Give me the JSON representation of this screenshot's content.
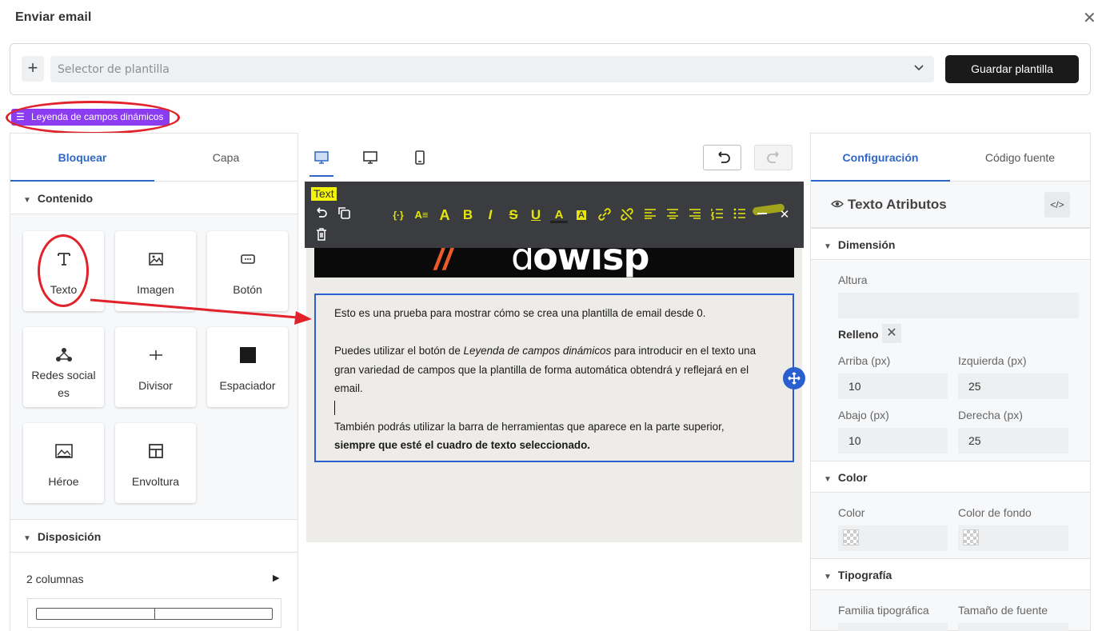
{
  "window": {
    "title": "Enviar email"
  },
  "template": {
    "selector_placeholder": "Selector de plantilla",
    "save_label": "Guardar plantilla"
  },
  "legend_button": {
    "label": "Leyenda de campos dinámicos"
  },
  "left_panel": {
    "tabs": [
      "Bloquear",
      "Capa"
    ],
    "content_section": "Contenido",
    "blocks": [
      {
        "label": "Texto",
        "icon": "text-icon"
      },
      {
        "label": "Imagen",
        "icon": "image-icon"
      },
      {
        "label": "Botón",
        "icon": "button-icon"
      },
      {
        "label": "Redes social es",
        "icon": "social-icon"
      },
      {
        "label": "Divisor",
        "icon": "divider-icon"
      },
      {
        "label": "Espaciador",
        "icon": "spacer-icon"
      },
      {
        "label": "Héroe",
        "icon": "hero-icon"
      },
      {
        "label": "Envoltura",
        "icon": "wrapper-icon"
      }
    ],
    "layout_section": "Disposición",
    "two_columns": "2 columnas"
  },
  "editor": {
    "toolbar_title": "Text",
    "logo_text": "owisp",
    "logo_slash": "//",
    "paragraph1": "Esto es una prueba para mostrar cómo se crea una plantilla de email desde 0.",
    "paragraph2_pre": "Puedes utilizar el botón de ",
    "paragraph2_em": "Leyenda de campos dinámicos",
    "paragraph2_post": " para introducir en el texto una gran variedad de campos que la plantilla de forma automática obtendrá y reflejará en el email.",
    "paragraph3": "También podrás utilizar la barra de herramientas que aparece en la parte superior,",
    "paragraph3_bold": "siempre que esté el cuadro de texto seleccionado."
  },
  "right_panel": {
    "tabs": [
      "Configuración",
      "Código fuente"
    ],
    "attributes_title": "Texto Atributos",
    "dimension_section": "Dimensión",
    "height_label": "Altura",
    "padding_label": "Relleno",
    "top_label": "Arriba (px)",
    "top_value": "10",
    "left_label": "Izquierda (px)",
    "left_value": "25",
    "bottom_label": "Abajo (px)",
    "bottom_value": "10",
    "right_label": "Derecha (px)",
    "right_value": "25",
    "color_section": "Color",
    "color_label": "Color",
    "bg_color_label": "Color de fondo",
    "typography_section": "Tipografía",
    "font_family_label": "Familia tipográfica",
    "font_size_label": "Tamaño de fuente"
  },
  "colors": {
    "accent": "#2f66c8",
    "legend_purple": "#8b3cf0",
    "annotation_red": "#e2222a",
    "toolbar_yellow": "#e6e60c"
  }
}
